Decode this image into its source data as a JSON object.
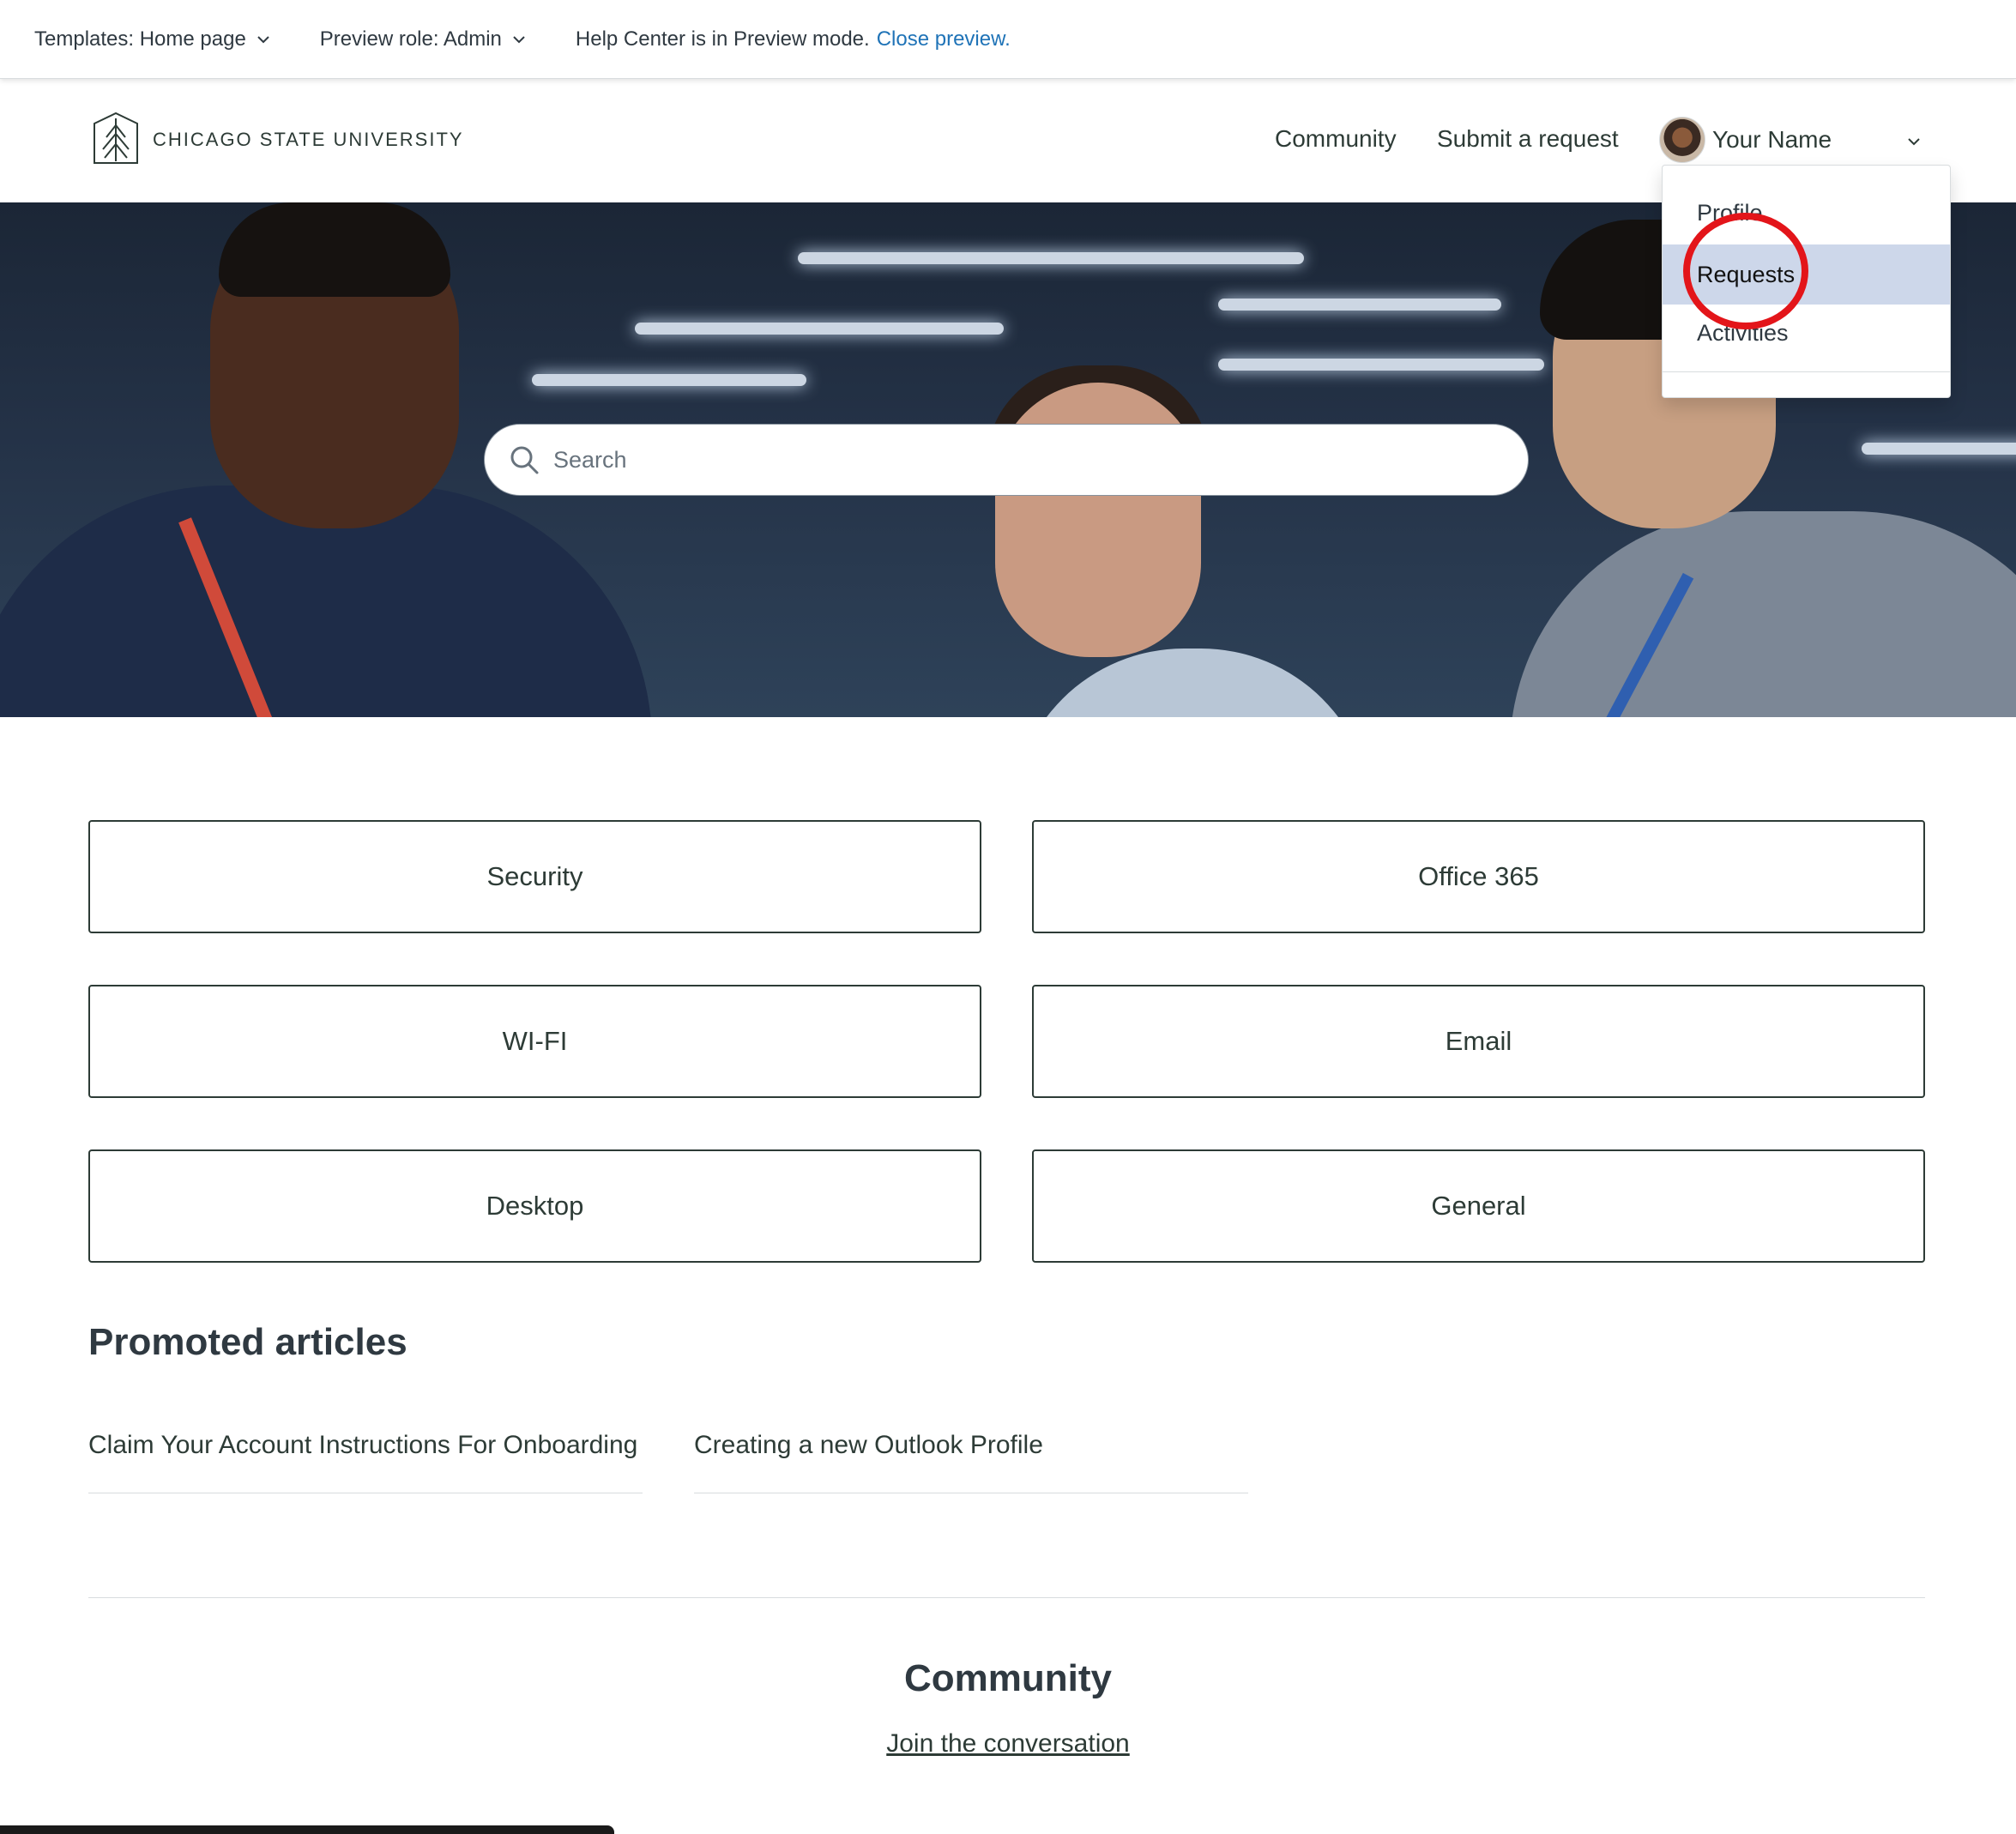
{
  "preview_bar": {
    "templates_label": "Templates: Home page",
    "role_label": "Preview role: Admin",
    "status_text": "Help Center is in Preview mode.",
    "close_link": "Close preview."
  },
  "header": {
    "logo_text": "CHICAGO STATE UNIVERSITY",
    "nav": {
      "community": "Community",
      "submit_request": "Submit a request"
    },
    "user": {
      "name": "Your Name"
    }
  },
  "user_menu": {
    "items": [
      {
        "label": "Profile"
      },
      {
        "label": "Requests",
        "highlighted": true
      },
      {
        "label": "Activities"
      }
    ]
  },
  "hero": {
    "search_placeholder": "Search"
  },
  "categories": [
    {
      "label": "Security"
    },
    {
      "label": "Office 365"
    },
    {
      "label": "WI-FI"
    },
    {
      "label": "Email"
    },
    {
      "label": "Desktop"
    },
    {
      "label": "General"
    }
  ],
  "promoted": {
    "title": "Promoted articles",
    "articles": [
      {
        "title": "Claim Your Account Instructions For Onboarding"
      },
      {
        "title": "Creating a new Outlook Profile"
      }
    ]
  },
  "community": {
    "title": "Community",
    "link": "Join the conversation"
  },
  "colors": {
    "brand_text": "#2d3b36",
    "link_blue": "#1f73b7",
    "menu_highlight": "#cdd7ea",
    "annotation_red": "#e3151a"
  }
}
